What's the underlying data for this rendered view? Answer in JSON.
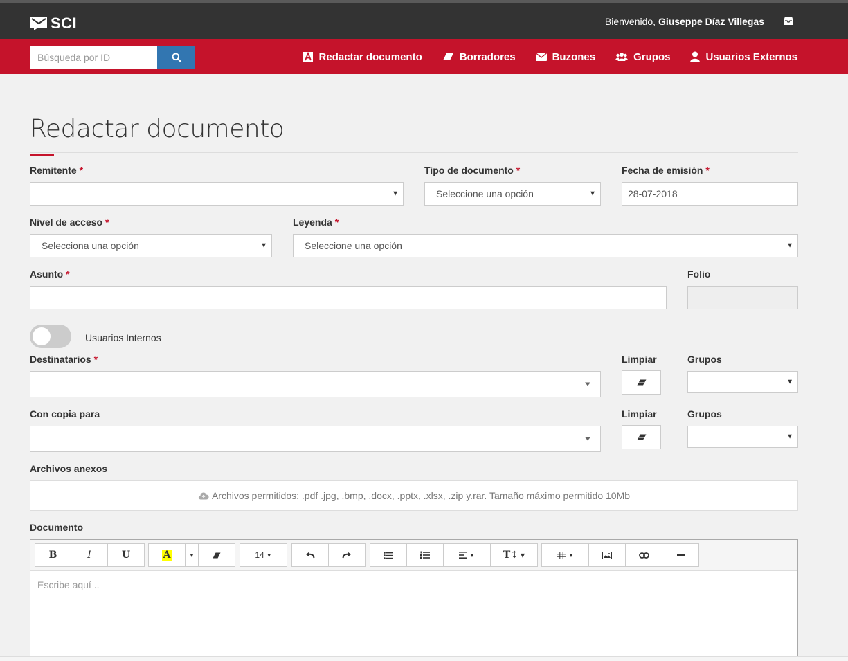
{
  "header": {
    "logo_text": "SCI",
    "welcome_prefix": "Bienvenido, ",
    "user_name": "Giuseppe Díaz Villegas"
  },
  "search": {
    "placeholder": "Búsqueda por ID"
  },
  "nav": {
    "compose": "Redactar documento",
    "drafts": "Borradores",
    "mailboxes": "Buzones",
    "groups": "Grupos",
    "external_users": "Usuarios Externos"
  },
  "page": {
    "title": "Redactar documento"
  },
  "form": {
    "required_mark": "*",
    "sender": {
      "label": "Remitente",
      "value": ""
    },
    "doc_type": {
      "label": "Tipo de documento",
      "value": "Seleccione una opción"
    },
    "issue_date": {
      "label": "Fecha de emisión",
      "value": "28-07-2018"
    },
    "access_level": {
      "label": "Nivel de acceso",
      "value": "Selecciona una opción"
    },
    "legend": {
      "label": "Leyenda",
      "value": "Seleccione una opción"
    },
    "subject": {
      "label": "Asunto",
      "value": ""
    },
    "folio": {
      "label": "Folio",
      "value": ""
    },
    "internal_users_toggle": {
      "label": "Usuarios Internos",
      "on": false
    },
    "recipients": {
      "label": "Destinatarios",
      "clear_label": "Limpiar",
      "groups_label": "Grupos"
    },
    "cc": {
      "label": "Con copia para",
      "clear_label": "Limpiar",
      "groups_label": "Grupos"
    },
    "attachments": {
      "label": "Archivos anexos",
      "hint": "Archivos permitidos: .pdf .jpg, .bmp, .docx, .pptx, .xlsx, .zip y.rar. Tamaño máximo permitido 10Mb"
    },
    "document": {
      "label": "Documento",
      "placeholder": "Escribe aquí ..",
      "font_size": "14",
      "toolbar": {
        "bold": "B",
        "italic": "I",
        "underline": "U",
        "highlight": "A",
        "text_size": "T↕"
      }
    }
  },
  "colors": {
    "brand_red": "#c5132b",
    "topbar": "#333333",
    "search_blue": "#3276b1"
  }
}
